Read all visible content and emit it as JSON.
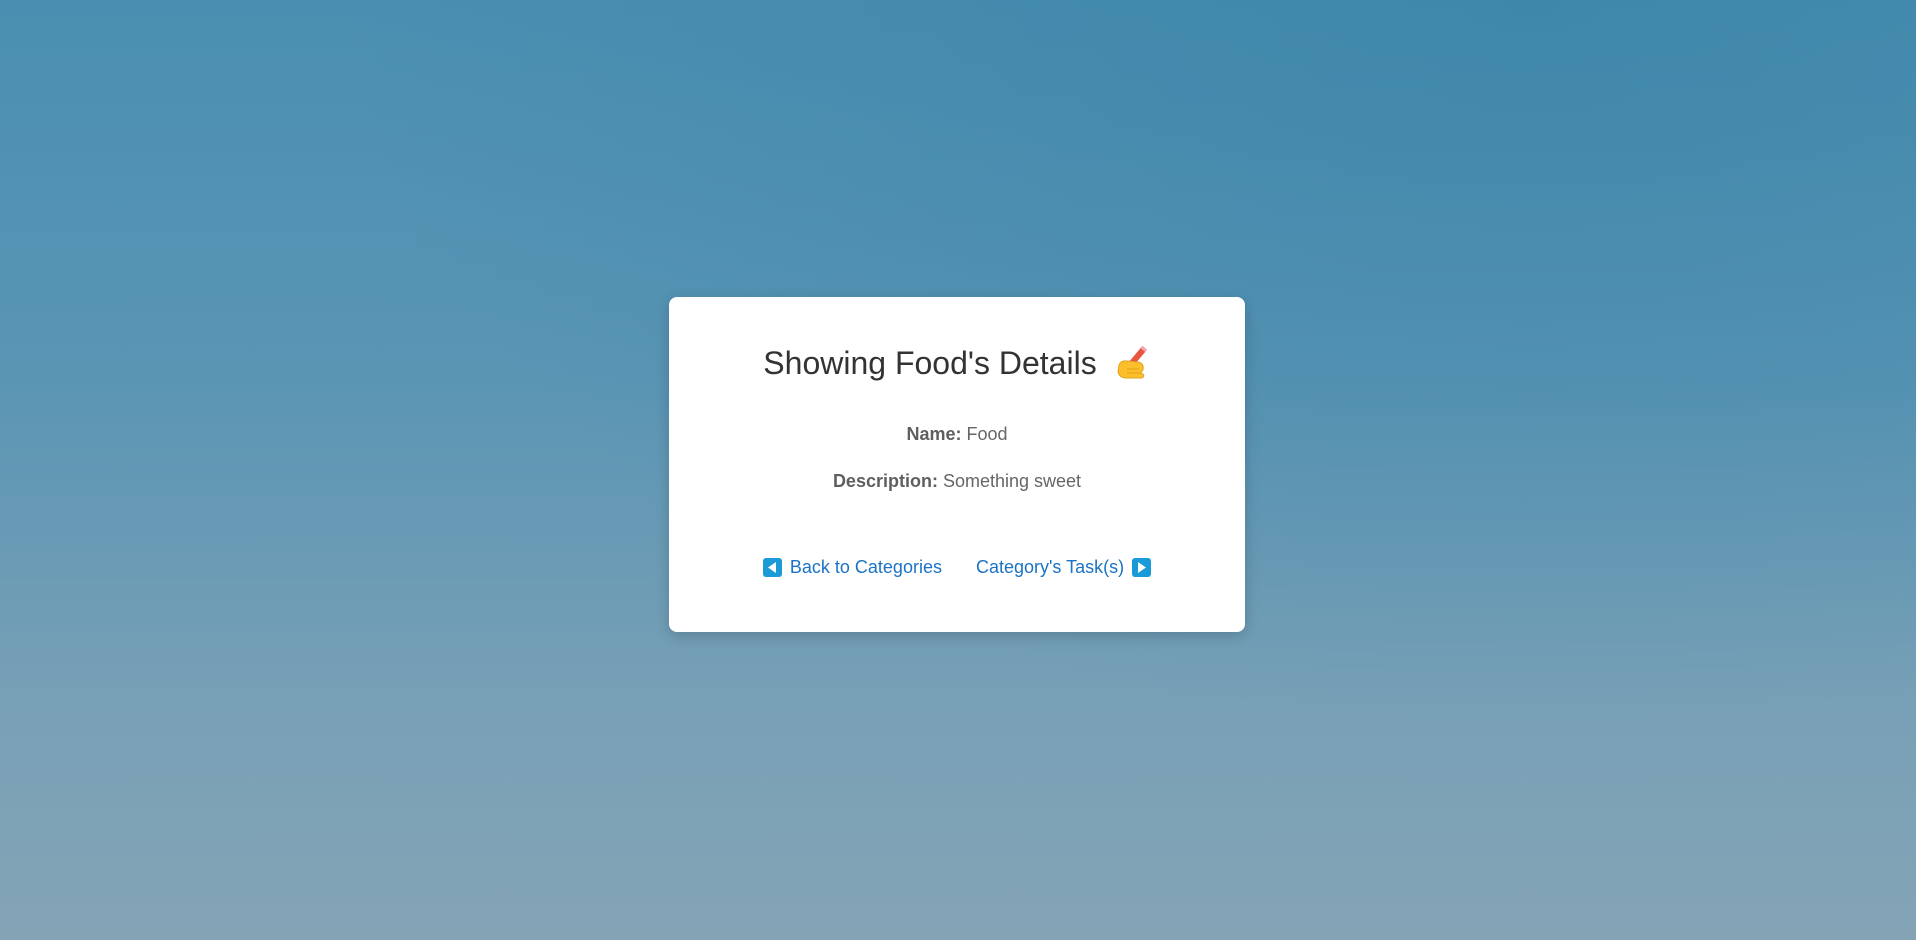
{
  "card": {
    "title": "Showing Food's Details",
    "title_icon": "writing-hand-icon",
    "name_label": "Name:",
    "name_value": "Food",
    "description_label": "Description:",
    "description_value": "Something sweet"
  },
  "links": {
    "back_label": "Back to Categories",
    "back_icon": "left-arrow-icon",
    "tasks_label": "Category's Task(s)",
    "tasks_icon": "right-arrow-icon"
  },
  "colors": {
    "background_top": "#4a8fb1",
    "background_bottom": "#84a4b6",
    "card": "#ffffff",
    "title": "#333333",
    "link": "#1a73c4",
    "arrow_box": "#1a9ad6"
  }
}
